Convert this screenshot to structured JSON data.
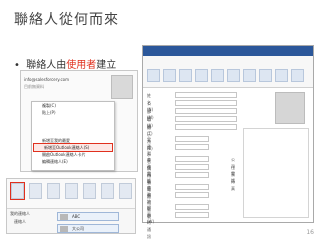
{
  "slide": {
    "title": "聯絡人從何而來",
    "bullet_prefix": "聯絡人由",
    "bullet_highlight": "使用者",
    "bullet_suffix": "建立",
    "page_number": "16",
    "accent_color": "#e0301e"
  },
  "mini_panel": {
    "email": "info@salesforcery.com",
    "subtitle": "目前無資料",
    "menu_items": [
      "複製(C)",
      "貼上(P)",
      "",
      "",
      "",
      "新增至我的最愛",
      "新增至Outlook連絡人(S)",
      "開啟Outlook連絡人卡片",
      "編輯連絡人(E)"
    ],
    "selected_index": 6
  },
  "contact_form": {
    "fields_left": [
      "姓名(N)",
      "公司(M)",
      "部門(A)",
      "職稱(T)",
      "顯示為(E)",
      "電子郵件",
      "顯示名稱(I)",
      "商務電話",
      "住家電話",
      "行動電話",
      "商務地址",
      "郵遞區號",
      "網頁(W)",
      "即時通訊"
    ],
    "fields_right": [
      "公司電話",
      "住家傳真",
      "",
      "",
      "",
      "",
      "",
      "",
      ""
    ]
  },
  "people_panel": {
    "nav_label": "我的連絡人",
    "nav_sub": "連絡人",
    "cards": [
      "ABC",
      "大公司"
    ]
  }
}
